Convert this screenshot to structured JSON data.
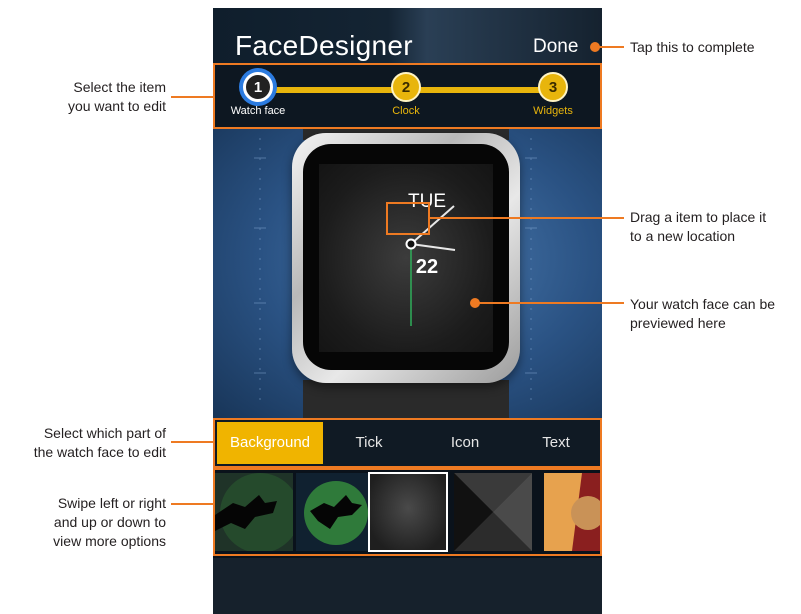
{
  "app": {
    "title": "FaceDesigner",
    "done_label": "Done"
  },
  "steps": [
    {
      "number": "1",
      "label": "Watch face",
      "state": "active"
    },
    {
      "number": "2",
      "label": "Clock",
      "state": "inactive"
    },
    {
      "number": "3",
      "label": "Widgets",
      "state": "inactive"
    }
  ],
  "watch": {
    "day": "TUE",
    "date": "22"
  },
  "tabs": [
    {
      "label": "Background",
      "active": true
    },
    {
      "label": "Tick",
      "active": false
    },
    {
      "label": "Icon",
      "active": false
    },
    {
      "label": "Text",
      "active": false
    }
  ],
  "options": [
    "witch-silhouette",
    "witch-moon",
    "dark-gradient",
    "metal-cone",
    "orange-circle"
  ],
  "callouts": {
    "done": "Tap this to complete",
    "steps_line1": "Select the item",
    "steps_line2": "you want to edit",
    "drag_line1": "Drag a item to place it",
    "drag_line2": "to a new location",
    "preview_line1": "Your watch face can be",
    "preview_line2": "previewed here",
    "tabs_line1": "Select which part of",
    "tabs_line2": "the watch face to edit",
    "swipe_line1": "Swipe left or right",
    "swipe_line2": "and up or down to",
    "swipe_line3": "view more options"
  },
  "colors": {
    "accent_orange": "#ee7a22",
    "step_yellow": "#e8b50c",
    "tab_active": "#f0b400",
    "step_active_ring": "#2b7be0"
  }
}
